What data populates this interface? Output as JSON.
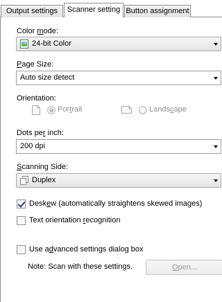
{
  "tabs": [
    {
      "label": "Output settings"
    },
    {
      "label": "Scanner setting"
    },
    {
      "label": "Button assignment"
    }
  ],
  "color_mode": {
    "label_pre": "Color ",
    "label_u": "m",
    "label_post": "ode:",
    "value": "24-bit Color"
  },
  "page_size": {
    "label_u": "P",
    "label_post": "age Size:",
    "value": "Auto size detect"
  },
  "orientation": {
    "label": "Orientation:",
    "portrait_pre": "Por",
    "portrait_u": "t",
    "portrait_post": "rait",
    "landscape_pre": "Lands",
    "landscape_u": "c",
    "landscape_post": "ape",
    "selected": "Portrait"
  },
  "dpi": {
    "label_pre": "Dots pe",
    "label_u": "r",
    "label_post": " inch:",
    "value": "200 dpi"
  },
  "scanning_side": {
    "label_u": "S",
    "label_post": "canning Side:",
    "value": "Duplex"
  },
  "deskew": {
    "label_pre": "Desk",
    "label_u": "e",
    "label_post": "w (automatically straightens skewed images)",
    "checked": true
  },
  "text_orientation": {
    "label_pre": "Text orientation ",
    "label_u": "r",
    "label_post": "ecognition",
    "checked": false
  },
  "advanced": {
    "label_pre": "Use a",
    "label_u": "d",
    "label_post": "vanced settings dialog box",
    "checked": false
  },
  "note": "Note: Scan with these settings.",
  "open_button": {
    "label_u": "O",
    "label_post": "pen..."
  }
}
